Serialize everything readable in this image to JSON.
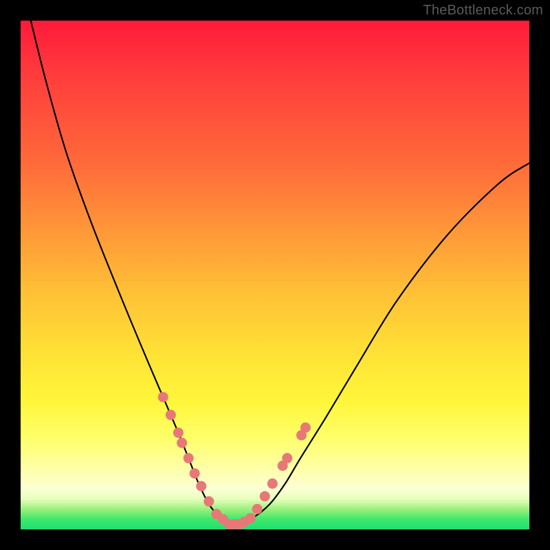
{
  "watermark": "TheBottleneck.com",
  "chart_data": {
    "type": "line",
    "title": "",
    "xlabel": "",
    "ylabel": "",
    "ylim": [
      0,
      100
    ],
    "xlim": [
      0,
      100
    ],
    "series": [
      {
        "name": "curve",
        "x": [
          2,
          5,
          9,
          14,
          20,
          25,
          28,
          31,
          33,
          35,
          37,
          39,
          41,
          43,
          46,
          49,
          52,
          55,
          60,
          66,
          74,
          84,
          94,
          100
        ],
        "y": [
          100,
          88,
          74,
          60,
          45,
          33,
          26,
          19,
          14,
          9,
          5,
          2.5,
          1,
          1,
          2.5,
          5,
          9,
          14,
          22,
          32,
          45,
          58,
          68,
          72
        ]
      }
    ],
    "markers": {
      "name": "dots",
      "x": [
        28,
        29.5,
        31,
        31.7,
        33,
        34.2,
        35.5,
        37,
        38.5,
        39.8,
        41,
        42,
        43,
        44,
        45.2,
        46.5,
        48,
        49.5,
        51.5,
        52.4,
        55.2,
        56
      ],
      "y": [
        26,
        22.5,
        19,
        17,
        14,
        11,
        8.5,
        5.5,
        3,
        2,
        1,
        1,
        1,
        1.5,
        2.2,
        4,
        6.5,
        9,
        12.5,
        14,
        18.5,
        20
      ]
    },
    "gradient_stops": [
      {
        "pos": 0,
        "color": "#ff1a3a"
      },
      {
        "pos": 50,
        "color": "#ffc236"
      },
      {
        "pos": 80,
        "color": "#ffff6a"
      },
      {
        "pos": 100,
        "color": "#20e070"
      }
    ]
  }
}
